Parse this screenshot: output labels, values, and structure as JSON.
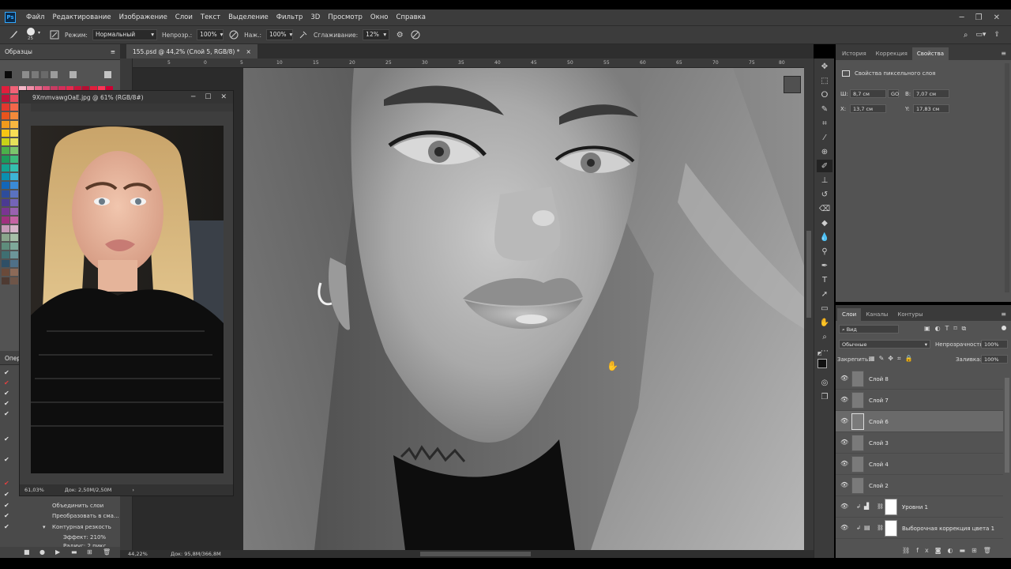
{
  "menu": {
    "logo": "Ps",
    "items": [
      "Файл",
      "Редактирование",
      "Изображение",
      "Слои",
      "Текст",
      "Выделение",
      "Фильтр",
      "3D",
      "Просмотр",
      "Окно",
      "Справка"
    ]
  },
  "options": {
    "brush_size": "25",
    "mode_label": "Режим:",
    "mode_value": "Нормальный",
    "opacity_label": "Непрозр.:",
    "opacity_value": "100%",
    "flow_label": "Наж.:",
    "flow_value": "100%",
    "smoothing_label": "Сглаживание:",
    "smoothing_value": "12%"
  },
  "left_panel": {
    "swatches_title": "Образцы",
    "ops_title": "Опер",
    "ops_items": [
      "Объединить слои",
      "Преобразовать в сма...",
      "Контурная резкость",
      "Эффект: 210%",
      "Радиус: 2 пикс."
    ]
  },
  "document": {
    "tab_title": "155.psd @ 44,2% (Слой 5, RGB/8) *",
    "close": "×",
    "zoom": "44,22%",
    "doc_size": "Док: 95,8M/366,8M",
    "ruler_ticks": [
      "5",
      "0",
      "5",
      "10",
      "15",
      "20",
      "25",
      "30",
      "35",
      "40",
      "45",
      "50",
      "55",
      "60",
      "65",
      "70",
      "75",
      "80",
      "85"
    ]
  },
  "ref_window": {
    "title": "9XmmvawgOaE.jpg @ 61% (RGB/8#)",
    "zoom": "61,03%",
    "doc_size": "Док: 2,50M/2,50M"
  },
  "properties": {
    "tabs": [
      "История",
      "Коррекция",
      "Свойства"
    ],
    "active_tab": "Свойства",
    "title": "Свойства пиксельного слоя",
    "w_label": "Ш:",
    "w_value": "8,7 см",
    "link": "GO",
    "h_label": "В:",
    "h_value": "7,07 см",
    "x_label": "Х:",
    "x_value": "13,7 см",
    "y_label": "Y:",
    "y_value": "17,83 см"
  },
  "layers": {
    "tabs": [
      "Слои",
      "Каналы",
      "Контуры"
    ],
    "active_tab": "Слои",
    "kind_filter": "Вид",
    "blend_mode": "Обычные",
    "opacity_label": "Непрозрачность:",
    "opacity_value": "100%",
    "lock_label": "Закрепить:",
    "fill_label": "Заливка:",
    "fill_value": "100%",
    "items": [
      {
        "name": "Слой 8",
        "selected": false
      },
      {
        "name": "Слой 7",
        "selected": false
      },
      {
        "name": "Слой 6",
        "selected": true
      },
      {
        "name": "Слой 3",
        "selected": false
      },
      {
        "name": "Слой 4",
        "selected": false
      },
      {
        "name": "Слой 2",
        "selected": false
      }
    ],
    "adjustments": [
      {
        "name": "Уровни 1"
      },
      {
        "name": "Выборочная коррекция цвета 1"
      }
    ]
  },
  "colors": {
    "menu_bg": "#3c3c3c",
    "panel_bg": "#535353",
    "canvas_bg": "#2b2b2b",
    "accent": "#31a8ff"
  }
}
